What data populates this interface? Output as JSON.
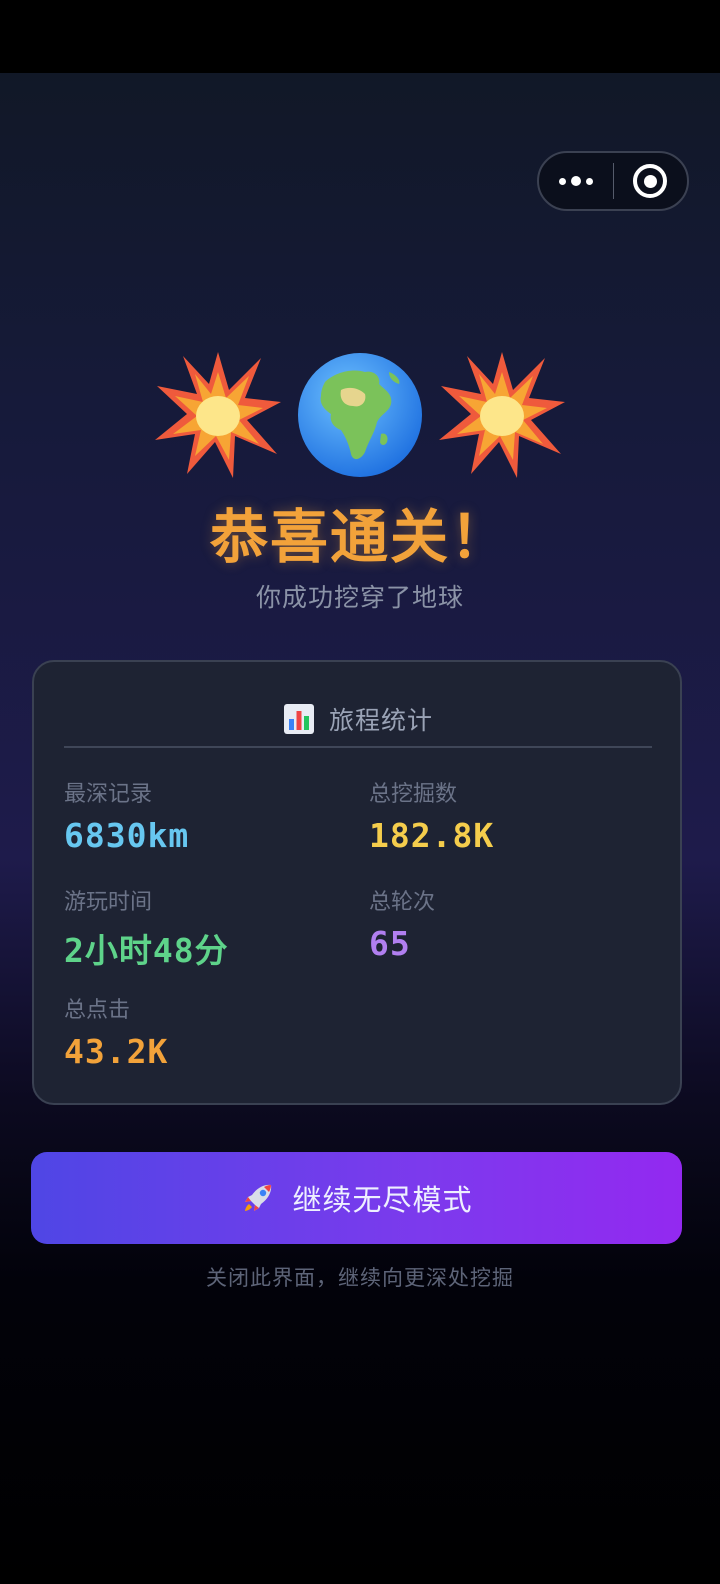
{
  "capsule": {
    "more_icon": "more-dots-icon",
    "close_icon": "target-circle-icon"
  },
  "hero": {
    "left_icon": "collision-burst-icon",
    "center_icon": "globe-africa-icon",
    "right_icon": "collision-burst-icon",
    "title": "恭喜通关！",
    "subtitle": "你成功挖穿了地球"
  },
  "stats_card": {
    "icon": "bar-chart-icon",
    "title": "旅程统计",
    "items": [
      {
        "label": "最深记录",
        "value": "6830km",
        "color": "#67c7f0"
      },
      {
        "label": "总挖掘数",
        "value": "182.8K",
        "color": "#f5cd4c"
      },
      {
        "label": "游玩时间",
        "value": "2小时48分",
        "color": "#5ed38a"
      },
      {
        "label": "总轮次",
        "value": "65",
        "color": "#b17ff0"
      },
      {
        "label": "总点击",
        "value": "43.2K",
        "color": "#f2a23a"
      }
    ]
  },
  "continue_button": {
    "icon": "rocket-icon",
    "label": "继续无尽模式"
  },
  "hint": "关闭此界面，继续向更深处挖掘",
  "colors": {
    "title": "#f2a23a",
    "button_start": "#4f46e5",
    "button_end": "#9329f0",
    "card_bg": "#1e2333"
  }
}
